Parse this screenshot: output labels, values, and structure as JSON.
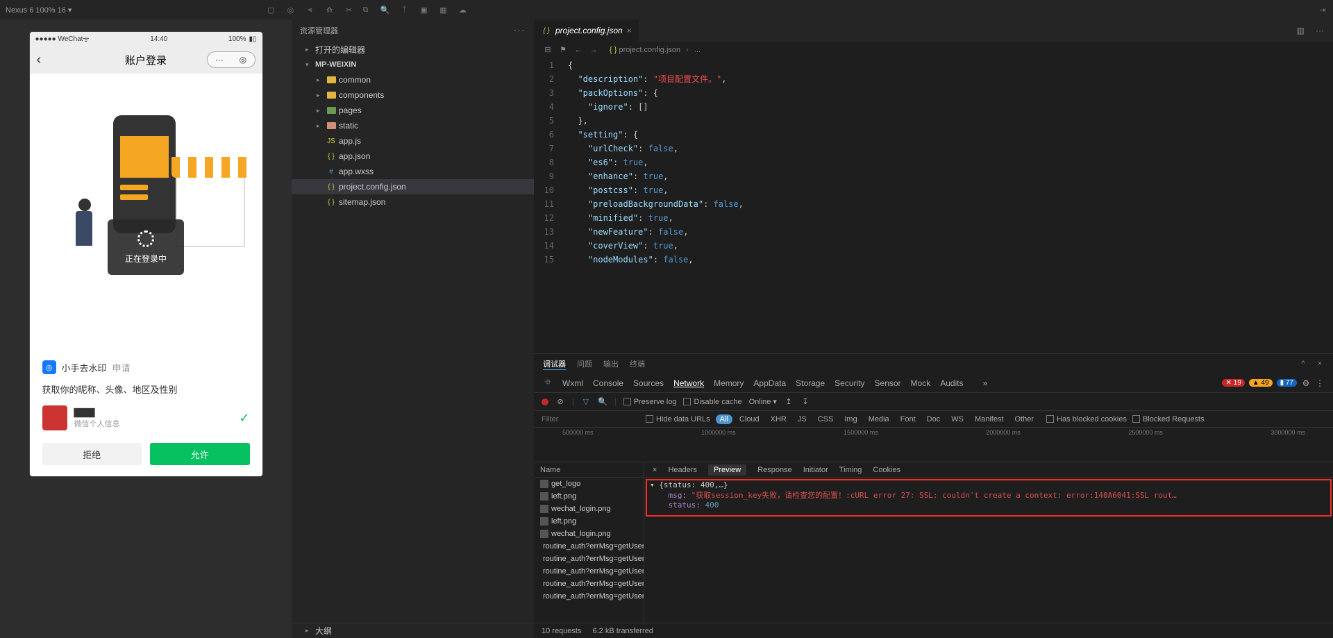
{
  "titlebar": {
    "device": "Nexus 6 100% 16 ▾"
  },
  "simulator": {
    "statusbar_left": "●●●●● WeChat",
    "statusbar_time": "14:40",
    "statusbar_batt": "100%",
    "nav_title": "账户登录",
    "loading": "正在登录中",
    "auth": {
      "app": "小手去水印",
      "apply": "申请",
      "scope": "获取你的昵称、头像、地区及性别",
      "nickname": "▇▇▇",
      "sub": "微信个人信息",
      "deny": "拒绝",
      "allow": "允许"
    }
  },
  "explorer": {
    "title": "资源管理器",
    "sections": {
      "open_editors": "打开的编辑器",
      "project": "MP-WEIXIN"
    },
    "tree": [
      {
        "label": "common",
        "kind": "folder-y",
        "indent": 2
      },
      {
        "label": "components",
        "kind": "folder-y",
        "indent": 2
      },
      {
        "label": "pages",
        "kind": "folder-g",
        "indent": 2
      },
      {
        "label": "static",
        "kind": "folder-o",
        "indent": 2
      },
      {
        "label": "app.js",
        "kind": "js",
        "indent": 2
      },
      {
        "label": "app.json",
        "kind": "json",
        "indent": 2
      },
      {
        "label": "app.wxss",
        "kind": "wxss",
        "indent": 2
      },
      {
        "label": "project.config.json",
        "kind": "json",
        "indent": 2,
        "sel": true
      },
      {
        "label": "sitemap.json",
        "kind": "json",
        "indent": 2
      }
    ]
  },
  "editor": {
    "tab": "project.config.json",
    "crumb1": "project.config.json",
    "crumb2": "...",
    "lines": [
      {
        "n": 1,
        "html": "<span class='tok-punc'>{</span>"
      },
      {
        "n": 2,
        "html": "  <span class='tok-key'>\"description\"</span>: <span class='tok-str-red'>\"项目配置文件。\"</span>,"
      },
      {
        "n": 3,
        "html": "  <span class='tok-key'>\"packOptions\"</span>: {"
      },
      {
        "n": 4,
        "html": "    <span class='tok-key'>\"ignore\"</span>: []"
      },
      {
        "n": 5,
        "html": "  },"
      },
      {
        "n": 6,
        "html": "  <span class='tok-key'>\"setting\"</span>: {"
      },
      {
        "n": 7,
        "html": "    <span class='tok-key'>\"urlCheck\"</span>: <span class='tok-bool'>false</span>,"
      },
      {
        "n": 8,
        "html": "    <span class='tok-key'>\"es6\"</span>: <span class='tok-bool'>true</span>,"
      },
      {
        "n": 9,
        "html": "    <span class='tok-key'>\"enhance\"</span>: <span class='tok-bool'>true</span>,"
      },
      {
        "n": 10,
        "html": "    <span class='tok-key'>\"postcss\"</span>: <span class='tok-bool'>true</span>,"
      },
      {
        "n": 11,
        "html": "    <span class='tok-key'>\"preloadBackgroundData\"</span>: <span class='tok-bool'>false</span>,"
      },
      {
        "n": 12,
        "html": "    <span class='tok-key'>\"minified\"</span>: <span class='tok-bool'>true</span>,"
      },
      {
        "n": 13,
        "html": "    <span class='tok-key'>\"newFeature\"</span>: <span class='tok-bool'>false</span>,"
      },
      {
        "n": 14,
        "html": "    <span class='tok-key'>\"coverView\"</span>: <span class='tok-bool'>true</span>,"
      },
      {
        "n": 15,
        "html": "    <span class='tok-key'>\"nodeModules\"</span>: <span class='tok-bool'>false</span>,"
      }
    ]
  },
  "panel": {
    "tabs": {
      "debugger": "调试器",
      "problems": "问题",
      "output": "输出",
      "terminal": "终端"
    },
    "devtabs": [
      "Wxml",
      "Console",
      "Sources",
      "Network",
      "Memory",
      "AppData",
      "Storage",
      "Security",
      "Sensor",
      "Mock",
      "Audits"
    ],
    "devtabs_active": "Network",
    "badges": {
      "err": "19",
      "warn": "49",
      "info": "77"
    },
    "toolbar": {
      "preserve": "Preserve log",
      "disable": "Disable cache",
      "online": "Online"
    },
    "filter": {
      "placeholder": "Filter",
      "hide": "Hide data URLs",
      "types": [
        "All",
        "Cloud",
        "XHR",
        "JS",
        "CSS",
        "Img",
        "Media",
        "Font",
        "Doc",
        "WS",
        "Manifest",
        "Other"
      ],
      "blocked_cookies": "Has blocked cookies",
      "blocked_req": "Blocked Requests"
    },
    "timeline_ticks": [
      "500000 ms",
      "1000000 ms",
      "1500000 ms",
      "2000000 ms",
      "2500000 ms",
      "3000000 ms"
    ],
    "name_hd": "Name",
    "requests": [
      "get_logo",
      "left.png",
      "wechat_login.png",
      "left.png",
      "wechat_login.png",
      "routine_auth?errMsg=getUser...",
      "routine_auth?errMsg=getUser...",
      "routine_auth?errMsg=getUser...",
      "routine_auth?errMsg=getUser...",
      "routine_auth?errMsg=getUser..."
    ],
    "detail_tabs": [
      "Headers",
      "Preview",
      "Response",
      "Initiator",
      "Timing",
      "Cookies"
    ],
    "detail_active": "Preview",
    "preview": {
      "l1": "▾ {status: 400,…}",
      "l2_key": "msg: ",
      "l2_val": "\"获取session_key失败，请检查您的配置！:cURL error 27: SSL: couldn't create a context: error:140A6041:SSL rout…",
      "l3_key": "status: ",
      "l3_val": "400"
    },
    "status": {
      "reqs": "10 requests",
      "xfer": "6.2 kB transferred"
    }
  },
  "footer": {
    "outline": "大纲"
  }
}
